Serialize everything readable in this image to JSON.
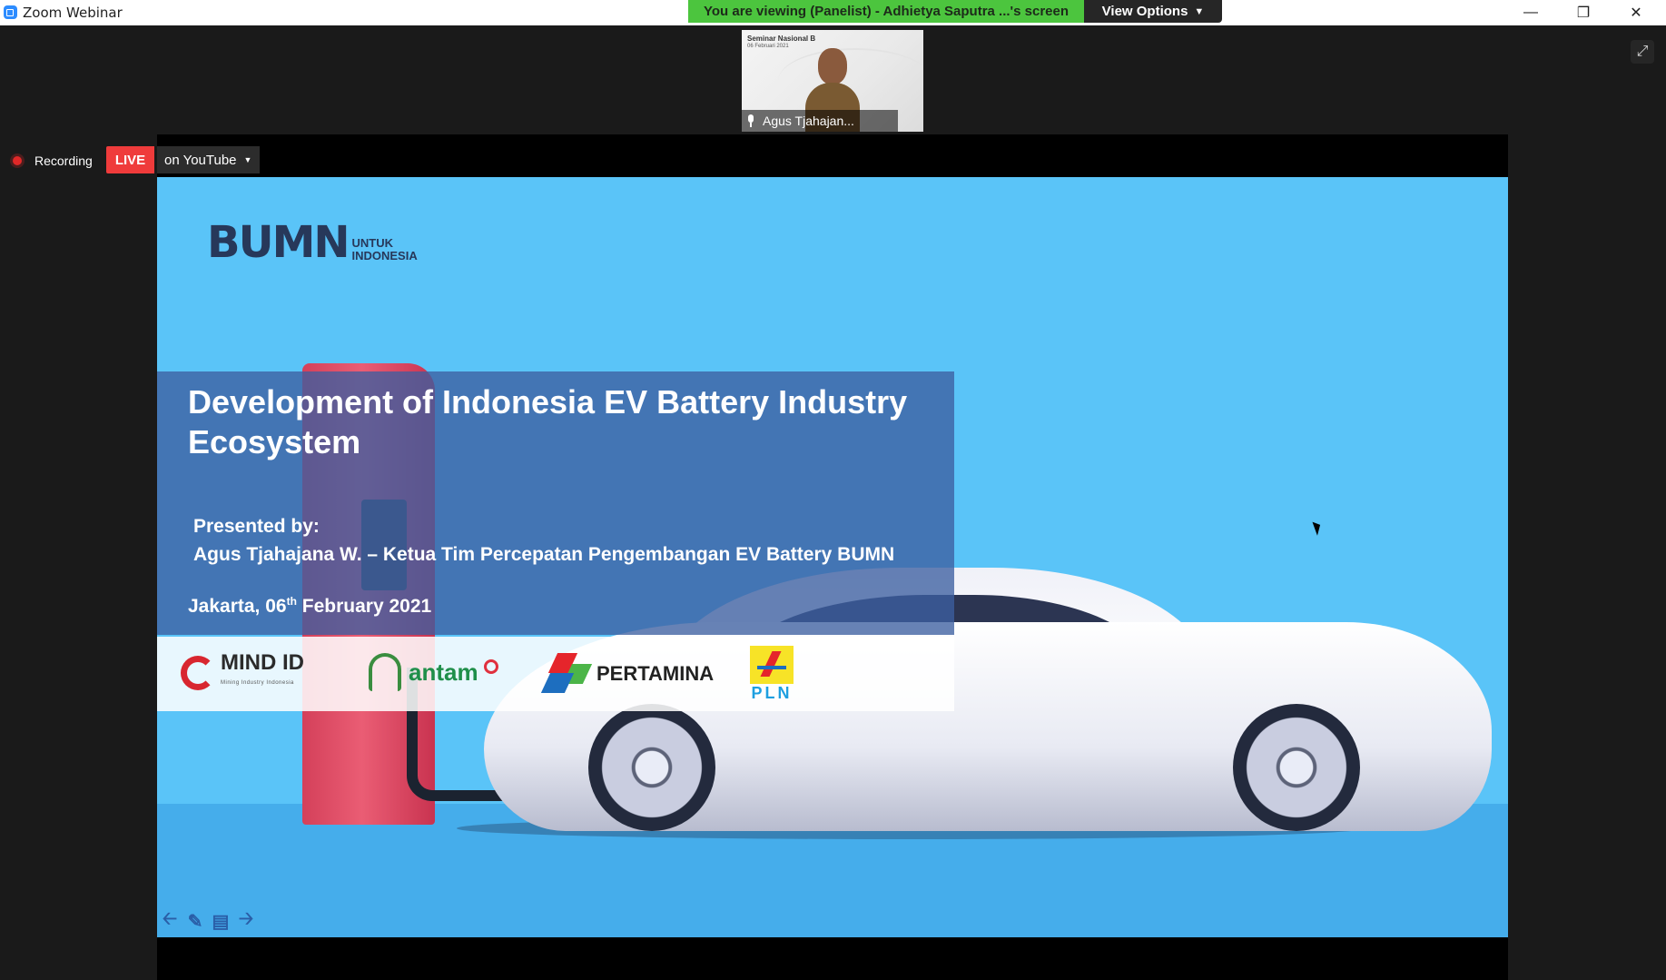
{
  "window": {
    "app_title": "Zoom Webinar",
    "minimize_icon": "minimize-icon",
    "restore_icon": "restore-icon",
    "close_icon": "close-icon"
  },
  "banner": {
    "viewing_text": "You are viewing (Panelist) - Adhietya Saputra ...'s screen",
    "view_options_label": "View Options",
    "banner_color": "#4cc53e"
  },
  "video_tile": {
    "header": "Seminar Nasional B",
    "date": "06 Februari 2021",
    "participant_name": "Agus Tjahajan..."
  },
  "recording": {
    "label": "Recording",
    "live_label": "LIVE",
    "stream_target": "on YouTube",
    "live_color": "#ef3b3b"
  },
  "slide": {
    "logo_mark": "BUMN",
    "logo_sub": "UNTUK INDONESIA",
    "title": "Development of Indonesia EV Battery Industry Ecosystem",
    "presented_label": "Presented by:",
    "presenter": "Agus Tjahajana W. – Ketua Tim Percepatan Pengembangan EV Battery BUMN",
    "place": "Jakarta, 06",
    "date_sup": "th",
    "date_rest": " February 2021",
    "logos": {
      "mindid": "MIND ID",
      "mindid_sub": "Mining Industry Indonesia",
      "antam": "antam",
      "pertamina": "PERTAMINA",
      "pln": "PLN"
    },
    "background_color": "#5ac4f8"
  },
  "slide_nav": {
    "prev_icon": "arrow-left-icon",
    "pen_icon": "pen-icon",
    "menu_icon": "slide-menu-icon",
    "next_icon": "arrow-right-icon"
  }
}
